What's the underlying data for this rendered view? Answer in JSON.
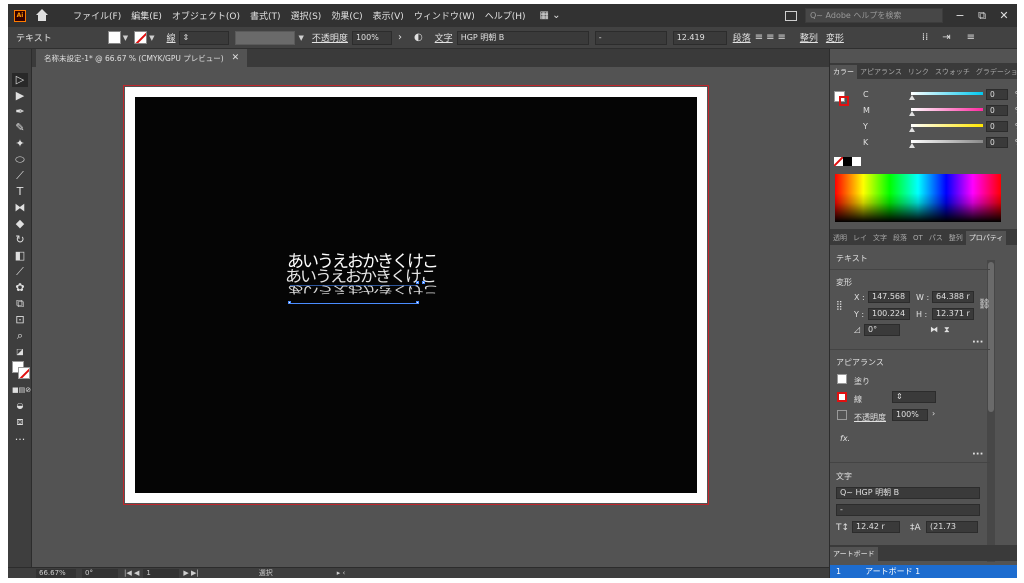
{
  "menubar": {
    "logo": "Ai",
    "items": [
      "ファイル(F)",
      "編集(E)",
      "オブジェクト(O)",
      "書式(T)",
      "選択(S)",
      "効果(C)",
      "表示(V)",
      "ウィンドウ(W)",
      "ヘルプ(H)"
    ],
    "search_placeholder": "Q~ Adobe ヘルプを検索",
    "window_controls": [
      "−",
      "⧉",
      "✕"
    ]
  },
  "controlbar": {
    "object_type": "テキスト",
    "stroke_label": "線",
    "opacity_label": "不透明度",
    "opacity_value": "100%",
    "char_label": "文字",
    "font_name": "HGP 明朝 B",
    "font_style": "-",
    "font_size": "12.419",
    "paragraph_label": "段落",
    "align_label": "整列",
    "transform_label": "変形"
  },
  "document": {
    "tab_title": "名称未設定-1* @ 66.67 % (CMYK/GPU プレビュー)",
    "tab_close": "✕",
    "art_text": "あいうえおかきくけこ"
  },
  "statusbar": {
    "zoom": "66.67%",
    "rotation": "0°",
    "artboard_nav": "1",
    "tool_label": "選択"
  },
  "color_panel": {
    "tabs": [
      "カラー",
      "アピアランス",
      "リンク",
      "スウォッチ",
      "グラデーション"
    ],
    "channels": [
      {
        "name": "C",
        "value": "0",
        "color": "#00c8f0"
      },
      {
        "name": "M",
        "value": "0",
        "color": "#ff2aa0"
      },
      {
        "name": "Y",
        "value": "0",
        "color": "#ffe600"
      },
      {
        "name": "K",
        "value": "0",
        "color": "#8a8a8a"
      }
    ],
    "pct": "%"
  },
  "properties_panel": {
    "tabs": [
      "透明",
      "レイ",
      "文字",
      "段落",
      "OT",
      "パス",
      "整列",
      "プロパティ"
    ],
    "selection_type": "テキスト",
    "transform_title": "変形",
    "x_label": "X :",
    "x_value": "147.568",
    "y_label": "Y :",
    "y_value": "100.224",
    "w_label": "W :",
    "w_value": "64.388 r",
    "h_label": "H :",
    "h_value": "12.371 r",
    "rotate_value": "0°",
    "appearance_title": "アピアランス",
    "fill_label": "塗り",
    "stroke_label": "線",
    "opacity_label": "不透明度",
    "opacity_value": "100%",
    "fx_label": "fx.",
    "char_title": "文字",
    "font_name": "Q~ HGP 明朝 B",
    "font_style": "-",
    "font_size": "12.42 r",
    "leading": "(21.73"
  },
  "artboards_panel": {
    "tab": "アートボード",
    "row_index": "1",
    "row_name": "アートボード 1"
  }
}
